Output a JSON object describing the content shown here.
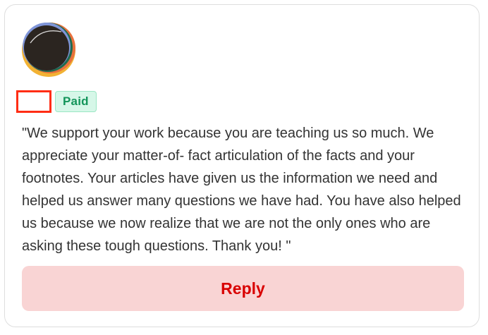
{
  "author": {
    "name": "",
    "avatar_icon": "abstract-avatar-icon",
    "badge": "Paid"
  },
  "comment": {
    "text": "\"We support your work because you are teaching us so much. We appreciate your matter-of- fact articulation of the facts and your footnotes. Your articles have given us the information we need and helped us answer many questions we have had. You have also helped us because we now realize that we are not the only ones who are asking these tough questions. Thank you! \""
  },
  "actions": {
    "reply_label": "Reply"
  },
  "colors": {
    "badge_bg": "#d6f7e8",
    "badge_text": "#13955a",
    "reply_bg": "#f9d4d4",
    "reply_text": "#d90000",
    "highlight_border": "#ff2d14"
  }
}
